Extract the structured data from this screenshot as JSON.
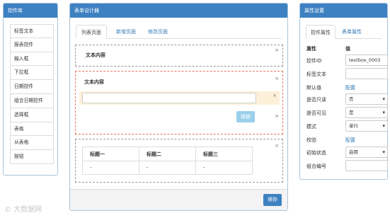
{
  "left": {
    "title": "控件库",
    "items": [
      "标签文本",
      "报表控件",
      "输入框",
      "下拉框",
      "日期控件",
      "组合日期控件",
      "选择框",
      "表格",
      "从表格",
      "按钮"
    ]
  },
  "center": {
    "title": "表单设计器",
    "tabs": [
      "列表页面",
      "新增页面",
      "修改页面"
    ],
    "close_glyph": "×",
    "block1_label": "文本内容",
    "block2_label": "文本内容",
    "select_button": "按链",
    "table_headers": [
      "标题一",
      "标题二",
      "标题三"
    ],
    "table_row": [
      "-",
      "-",
      "-"
    ],
    "save_button": "保存"
  },
  "right": {
    "title": "属性设置",
    "tabs": [
      "控件属性",
      "表单属性"
    ],
    "header_name": "属性",
    "header_value": "值",
    "props": [
      {
        "name": "控件ID",
        "value": "textbox_0003",
        "kind": "input"
      },
      {
        "name": "标签文本",
        "value": "",
        "kind": "input"
      },
      {
        "name": "默认值",
        "value": "配置",
        "kind": "link"
      },
      {
        "name": "是否只读",
        "value": "否",
        "kind": "select"
      },
      {
        "name": "是否可见",
        "value": "是",
        "kind": "select"
      },
      {
        "name": "模式",
        "value": "单行",
        "kind": "select"
      },
      {
        "name": "校验",
        "value": "配置",
        "kind": "link"
      },
      {
        "name": "初始状态",
        "value": "启用",
        "kind": "select"
      },
      {
        "name": "组合编号",
        "value": "",
        "kind": "input"
      }
    ]
  },
  "watermark": "© 大数据网"
}
